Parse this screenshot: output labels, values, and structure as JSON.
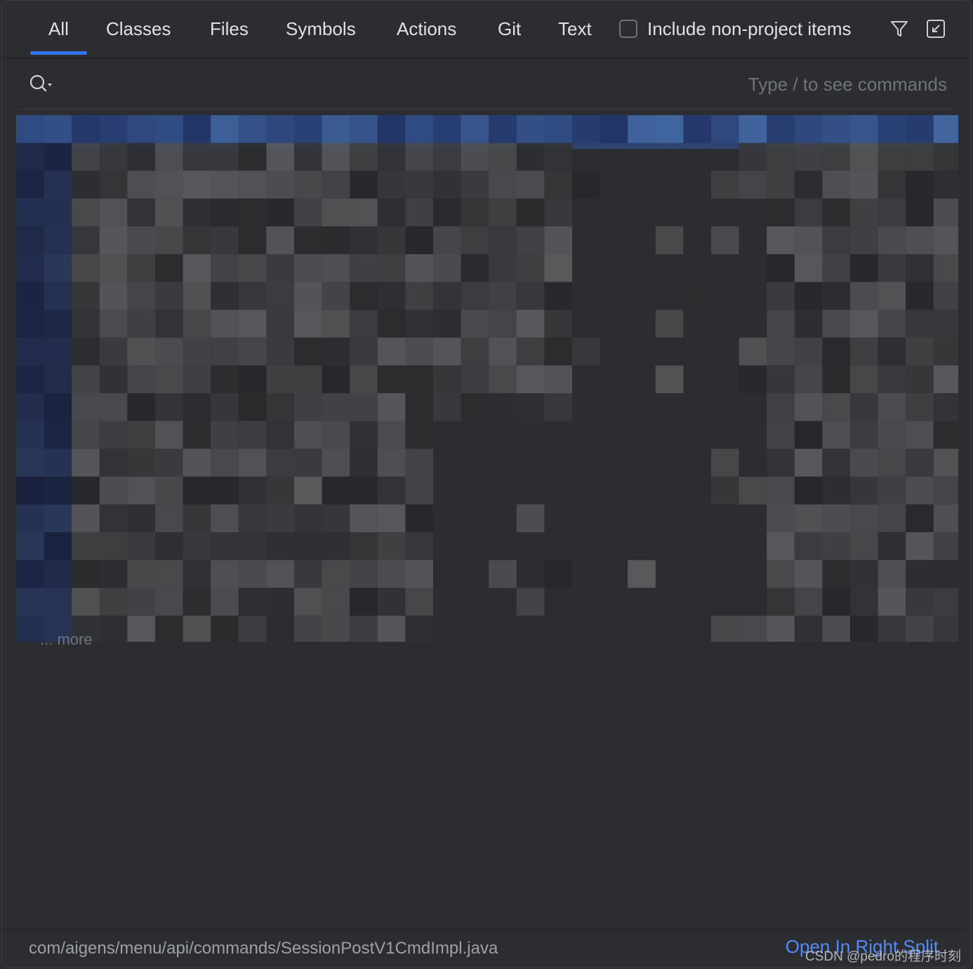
{
  "tabs": [
    {
      "label": "All",
      "active": true
    },
    {
      "label": "Classes",
      "active": false
    },
    {
      "label": "Files",
      "active": false
    },
    {
      "label": "Symbols",
      "active": false
    },
    {
      "label": "Actions",
      "active": false
    },
    {
      "label": "Git",
      "active": false
    },
    {
      "label": "Text",
      "active": false
    }
  ],
  "include_non_project": {
    "label": "Include non-project items",
    "checked": false
  },
  "toolbar_icons": [
    "filter-icon",
    "collapse-to-corner-icon"
  ],
  "search": {
    "placeholder": "Type / to see commands",
    "value": "",
    "icon": "search-icon"
  },
  "results": {
    "more_label": "... more",
    "obscured": true
  },
  "footer": {
    "path": "com/aigens/menu/api/commands/SessionPostV1CmdImpl.java",
    "open_link": "Open In Right Split"
  },
  "watermark": "CSDN @pedro的程序时刻",
  "colors": {
    "background": "#2b2d30",
    "accent": "#3574f0",
    "link": "#548af7",
    "selection": "#2e436e"
  }
}
